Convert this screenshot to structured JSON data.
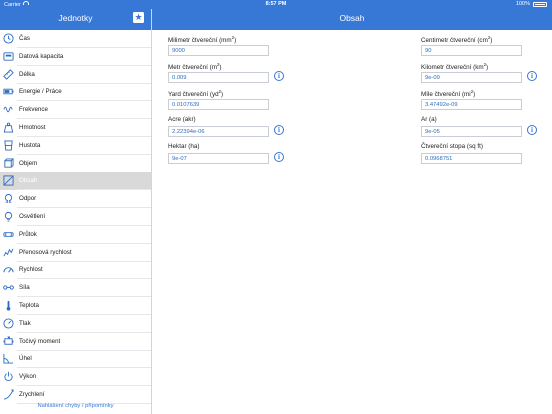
{
  "status": {
    "carrier": "Carrier",
    "time": "8:57 PM",
    "battery": "100%"
  },
  "sidebar": {
    "title": "Jednotky",
    "footer_link": "Nahlášení chyby / připomínky",
    "items": [
      {
        "label": "Čas",
        "icon": "clock-icon"
      },
      {
        "label": "Datová kapacita",
        "icon": "storage-icon"
      },
      {
        "label": "Délka",
        "icon": "ruler-icon"
      },
      {
        "label": "Energie / Práce",
        "icon": "battery-icon"
      },
      {
        "label": "Frekvence",
        "icon": "wave-icon"
      },
      {
        "label": "Hmotnost",
        "icon": "weight-icon"
      },
      {
        "label": "Hustota",
        "icon": "beaker-icon"
      },
      {
        "label": "Objem",
        "icon": "cube-icon"
      },
      {
        "label": "Obsah",
        "icon": "area-icon",
        "active": true
      },
      {
        "label": "Odpor",
        "icon": "omega-icon"
      },
      {
        "label": "Osvětlení",
        "icon": "bulb-icon"
      },
      {
        "label": "Průtok",
        "icon": "pipe-icon"
      },
      {
        "label": "Přenosová rychlost",
        "icon": "signal-icon"
      },
      {
        "label": "Rychlost",
        "icon": "speed-icon"
      },
      {
        "label": "Síla",
        "icon": "dumbbell-icon"
      },
      {
        "label": "Teplota",
        "icon": "thermometer-icon"
      },
      {
        "label": "Tlak",
        "icon": "gauge-icon"
      },
      {
        "label": "Točivý moment",
        "icon": "engine-icon"
      },
      {
        "label": "Úhel",
        "icon": "angle-icon"
      },
      {
        "label": "Výkon",
        "icon": "power-icon"
      },
      {
        "label": "Zrychlení",
        "icon": "acceleration-icon"
      }
    ]
  },
  "main": {
    "title": "Obsah",
    "left_fields": [
      {
        "label": "Milimetr čtvereční (mm",
        "sup": "2",
        "suffix": ")",
        "value": "9000",
        "info": false
      },
      {
        "label": "Metr čtvereční (m",
        "sup": "2",
        "suffix": ")",
        "value": "0.009",
        "info": true
      },
      {
        "label": "Yard čtvereční (yd",
        "sup": "2",
        "suffix": ")",
        "value": "0.0107639",
        "info": false
      },
      {
        "label": "Acre (akr)",
        "sup": "",
        "suffix": "",
        "value": "2.22394e-06",
        "info": true
      },
      {
        "label": "Hektar (ha)",
        "sup": "",
        "suffix": "",
        "value": "9e-07",
        "info": true
      }
    ],
    "right_fields": [
      {
        "label": "Centimetr čtvereční (cm",
        "sup": "2",
        "suffix": ")",
        "value": "90",
        "info": false
      },
      {
        "label": "Kilometr čtvereční (km",
        "sup": "2",
        "suffix": ")",
        "value": "9e-09",
        "info": true
      },
      {
        "label": "Míle čtvereční (mi",
        "sup": "2",
        "suffix": ")",
        "value": "3.47492e-09",
        "info": false
      },
      {
        "label": "Ar (a)",
        "sup": "",
        "suffix": "",
        "value": "9e-05",
        "info": true
      },
      {
        "label": "Čtvereční stopa (sq ft)",
        "sup": "",
        "suffix": "",
        "value": "0.0968751",
        "info": false
      }
    ]
  }
}
